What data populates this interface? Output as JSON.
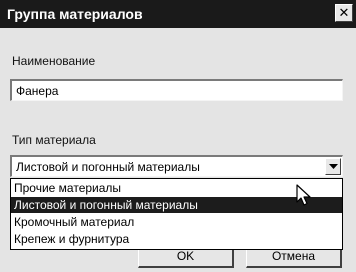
{
  "window": {
    "title": "Группа материалов",
    "close_glyph": "✕"
  },
  "name_field": {
    "label": "Наименование",
    "value": "Фанера"
  },
  "type_field": {
    "label": "Тип материала",
    "selected": "Листовой и погонный материалы",
    "options": [
      "Прочие материалы",
      "Листовой и погонный материалы",
      "Кромочный материал",
      "Крепеж и фурнитура"
    ]
  },
  "buttons": {
    "ok": "OK",
    "cancel": "Отмена"
  },
  "icons": {
    "close": "close-icon",
    "dropdown_arrow": "chevron-down-icon",
    "cursor": "mouse-pointer-icon"
  },
  "colors": {
    "titlebar": "#1a1a1a",
    "selection": "#1c1c1c",
    "dialog_bg": "#e4e4e4"
  }
}
